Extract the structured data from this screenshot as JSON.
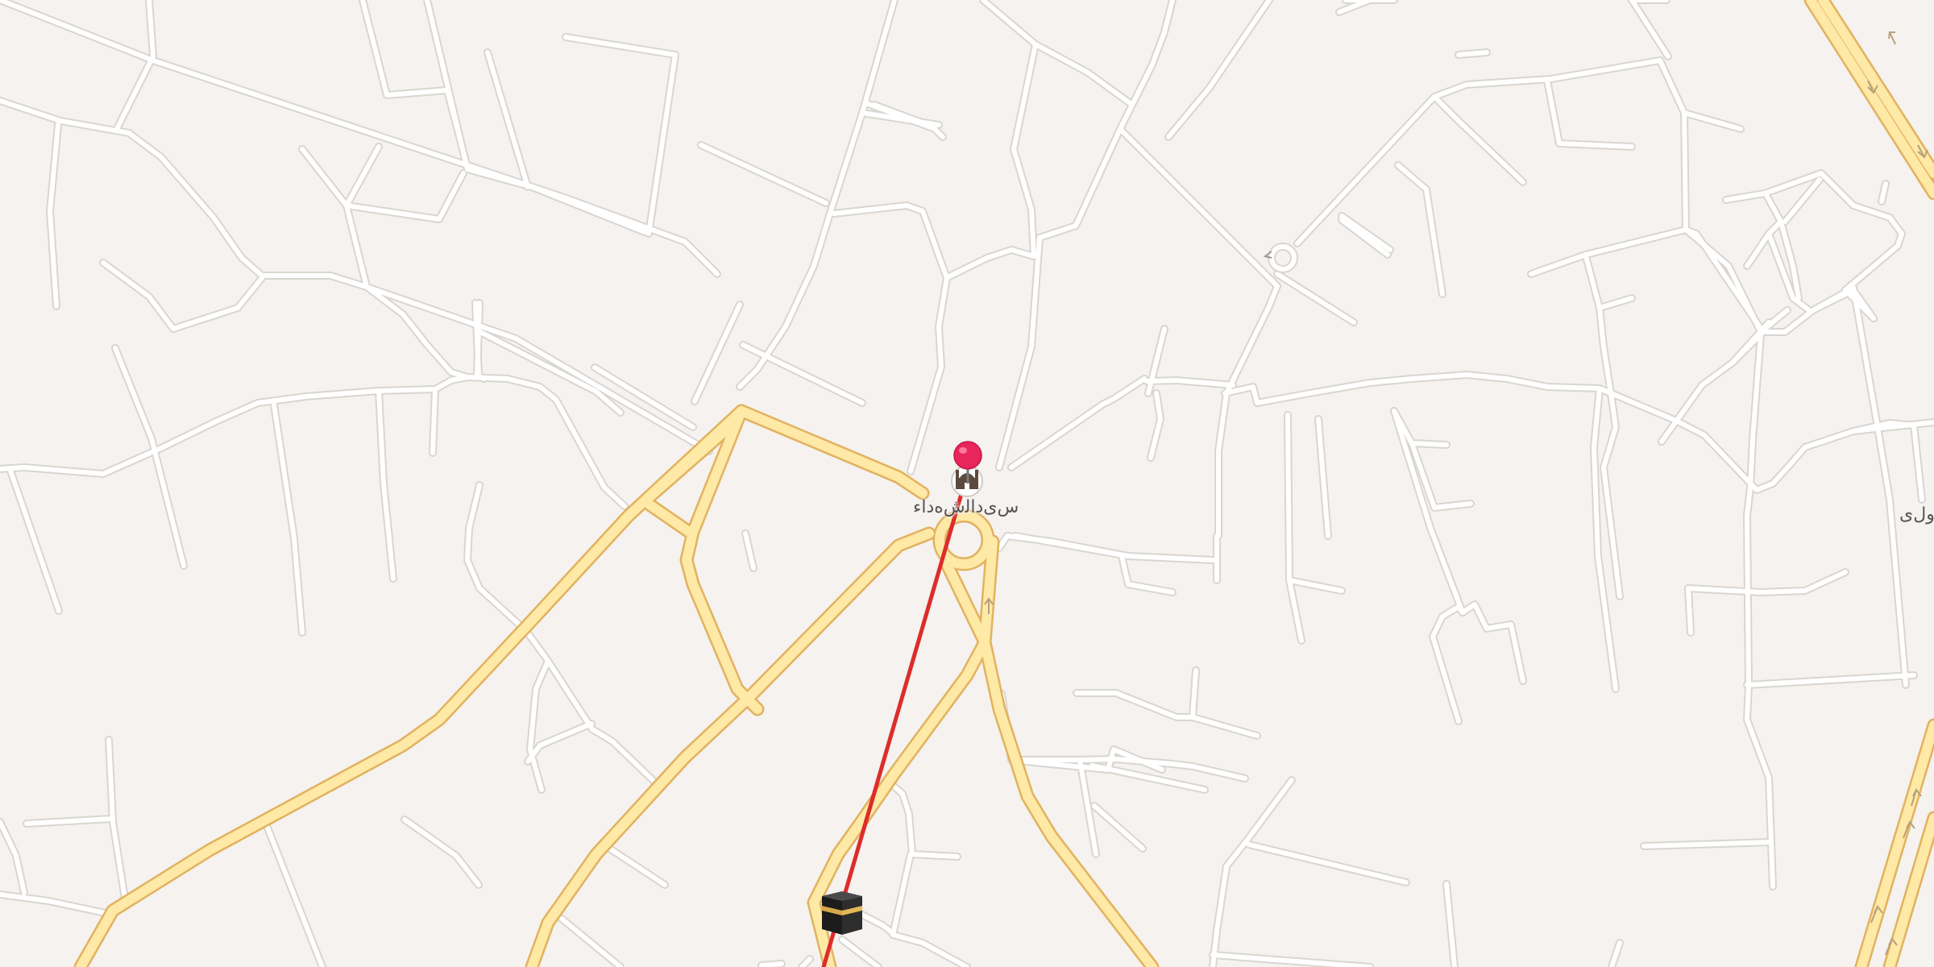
{
  "map": {
    "labels": {
      "station": "ﺱیﺩﺍﻟﺵﻩﺩﺍﺀ",
      "edge": "ﻭﻝی"
    },
    "pins": [
      {
        "name": "destination-pin",
        "icon": "red-pin-icon",
        "color": "#e8265b"
      }
    ],
    "landmarks": [
      {
        "name": "mosque",
        "icon": "mosque-icon"
      },
      {
        "name": "kaaba",
        "icon": "kaaba-icon"
      }
    ],
    "route": {
      "color": "#dd2c2c"
    },
    "colors": {
      "background": "#f5f2ef",
      "street": "#ffffff",
      "street_outline": "#d9d6d2",
      "main_road": "#fee9a6",
      "main_road_outline": "#e2b25f"
    }
  }
}
